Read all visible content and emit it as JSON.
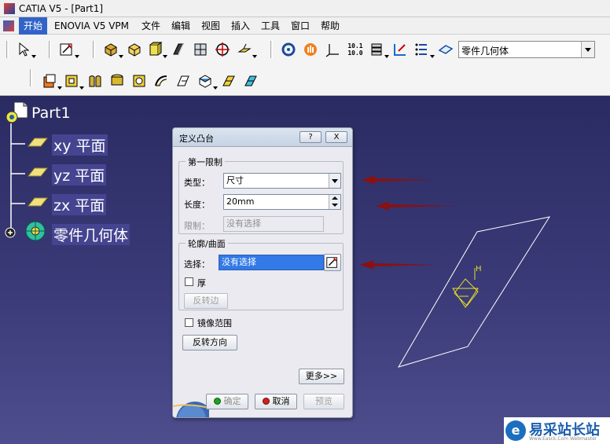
{
  "window": {
    "title": "CATIA V5 - [Part1]"
  },
  "menu": [
    {
      "label": "开始"
    },
    {
      "label": "ENOVIA V5 VPM"
    },
    {
      "label": "文件"
    },
    {
      "label": "编辑"
    },
    {
      "label": "视图"
    },
    {
      "label": "插入"
    },
    {
      "label": "工具"
    },
    {
      "label": "窗口"
    },
    {
      "label": "帮助"
    }
  ],
  "toolbar": {
    "workbench_combo": "零件几何体",
    "measure_label_top": "10.1",
    "measure_label_bottom": "10.0"
  },
  "tree": {
    "root": "Part1",
    "items": [
      {
        "label": "xy 平面",
        "icon": "plane-icon"
      },
      {
        "label": "yz 平面",
        "icon": "plane-icon"
      },
      {
        "label": "zx 平面",
        "icon": "plane-icon"
      },
      {
        "label": "零件几何体",
        "icon": "body-icon"
      }
    ]
  },
  "dialog": {
    "title": "定义凸台",
    "help_btn": "?",
    "close_btn": "X",
    "first_limit": {
      "title": "第一限制",
      "type_label": "类型：",
      "type_value": "尺寸",
      "length_label": "长度：",
      "length_value": "20mm",
      "limit_label": "限制：",
      "limit_value": "没有选择"
    },
    "profile": {
      "title": "轮廓/曲面",
      "select_label": "选择：",
      "select_value": "没有选择",
      "thick_label": "厚",
      "reverse_side": "反转边"
    },
    "mirror_label": "镜像范围",
    "reverse_direction": "反转方向",
    "more": "更多>>",
    "ok": "确定",
    "cancel": "取消",
    "preview": "预览"
  },
  "sketch": {
    "axis_label": "H"
  },
  "watermark": {
    "title": "易采站长站",
    "subtitle": "Www.Easck.Com Webmaster",
    "logo": "e"
  },
  "colors": {
    "background_top": "#2b2b63",
    "background_bottom": "#4e4e8e",
    "selection": "#3379e8",
    "arrow": "#8b1010",
    "sketch_yellow": "#e8e020"
  }
}
